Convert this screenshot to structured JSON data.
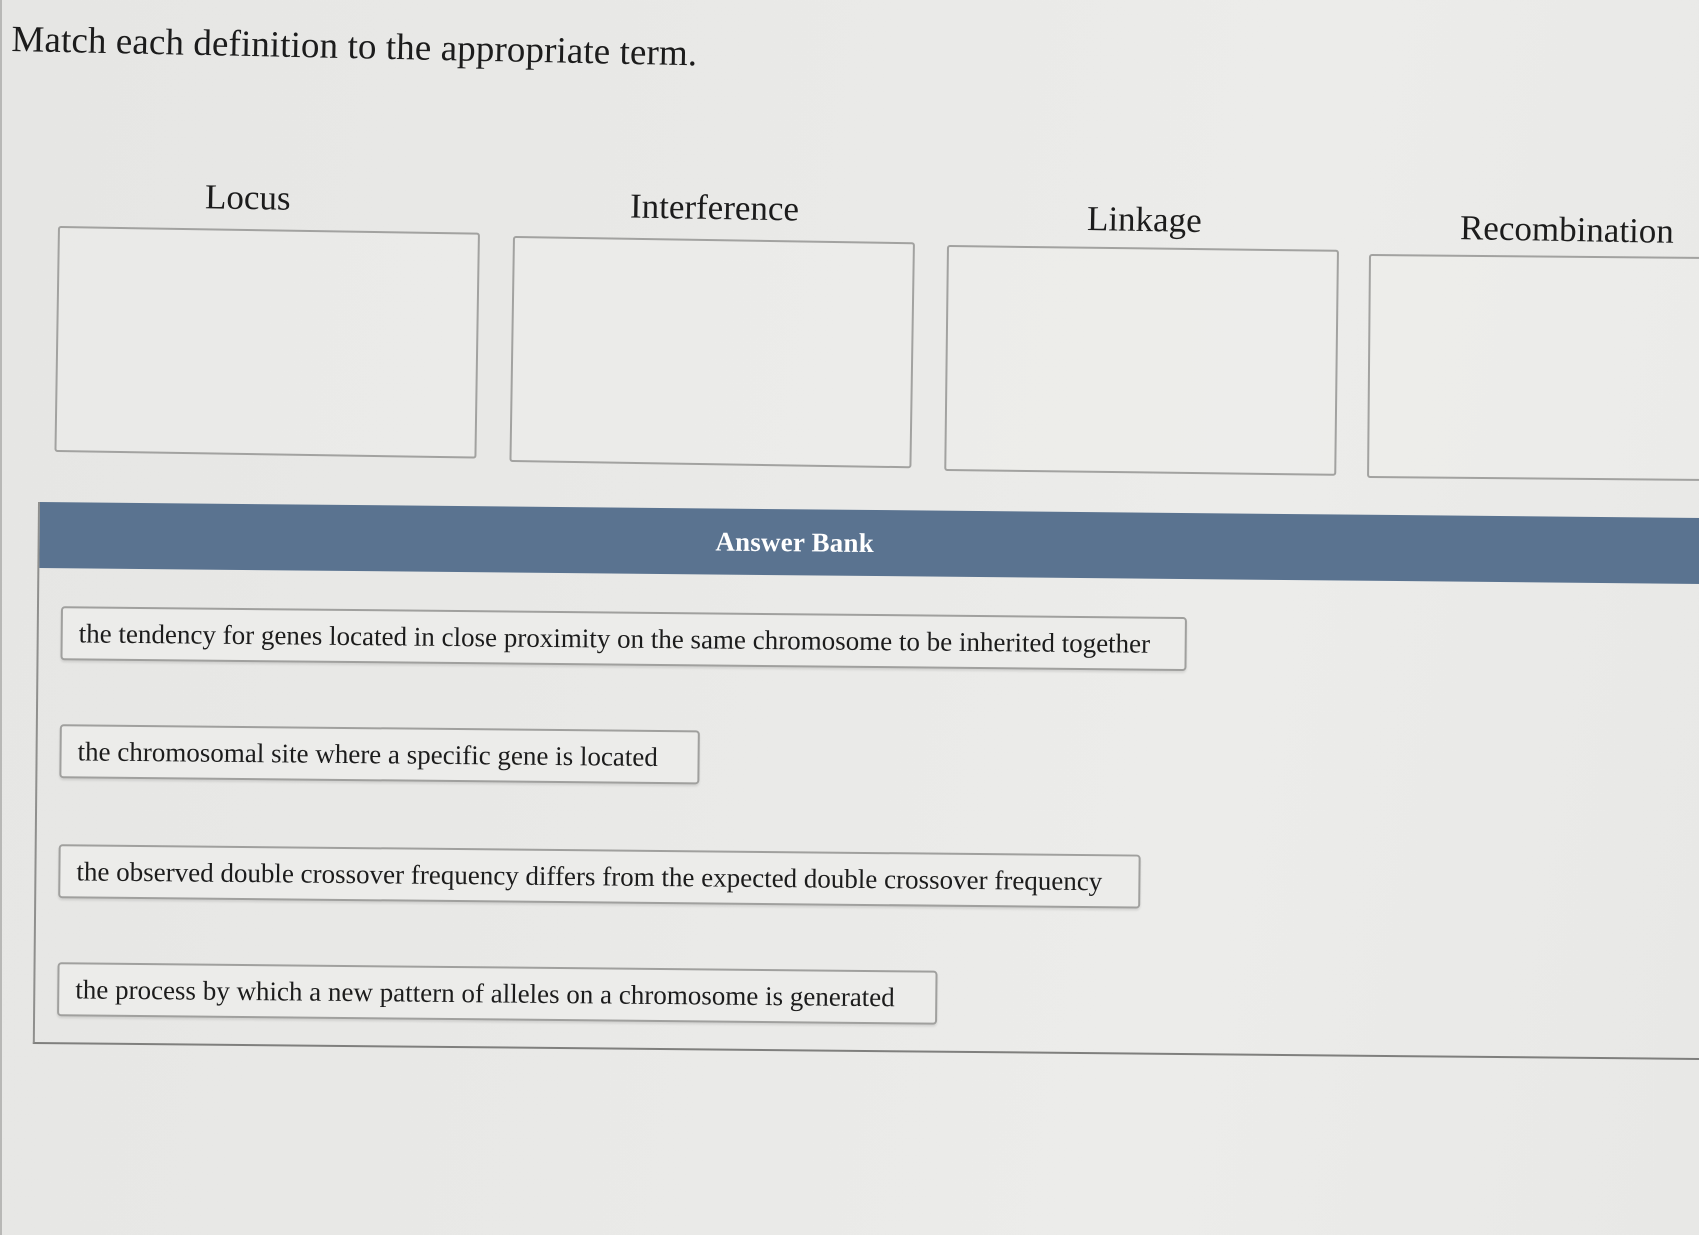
{
  "question": {
    "title": "Match each definition to the appropriate term."
  },
  "terms": [
    {
      "label": "Locus"
    },
    {
      "label": "Interference"
    },
    {
      "label": "Linkage"
    },
    {
      "label": "Recombination"
    }
  ],
  "answer_bank": {
    "title": "Answer Bank",
    "items": [
      {
        "text": "the tendency for genes located in close proximity on the same chromosome to be inherited together"
      },
      {
        "text": "the chromosomal site where a specific gene is located"
      },
      {
        "text": "the observed double crossover frequency differs from the expected double crossover frequency"
      },
      {
        "text": "the process by which a new pattern of alleles on a chromosome is generated"
      }
    ]
  },
  "colors": {
    "bank_header": "#5a7390",
    "background": "#e9e9e7",
    "card_border": "#a0a09e"
  }
}
